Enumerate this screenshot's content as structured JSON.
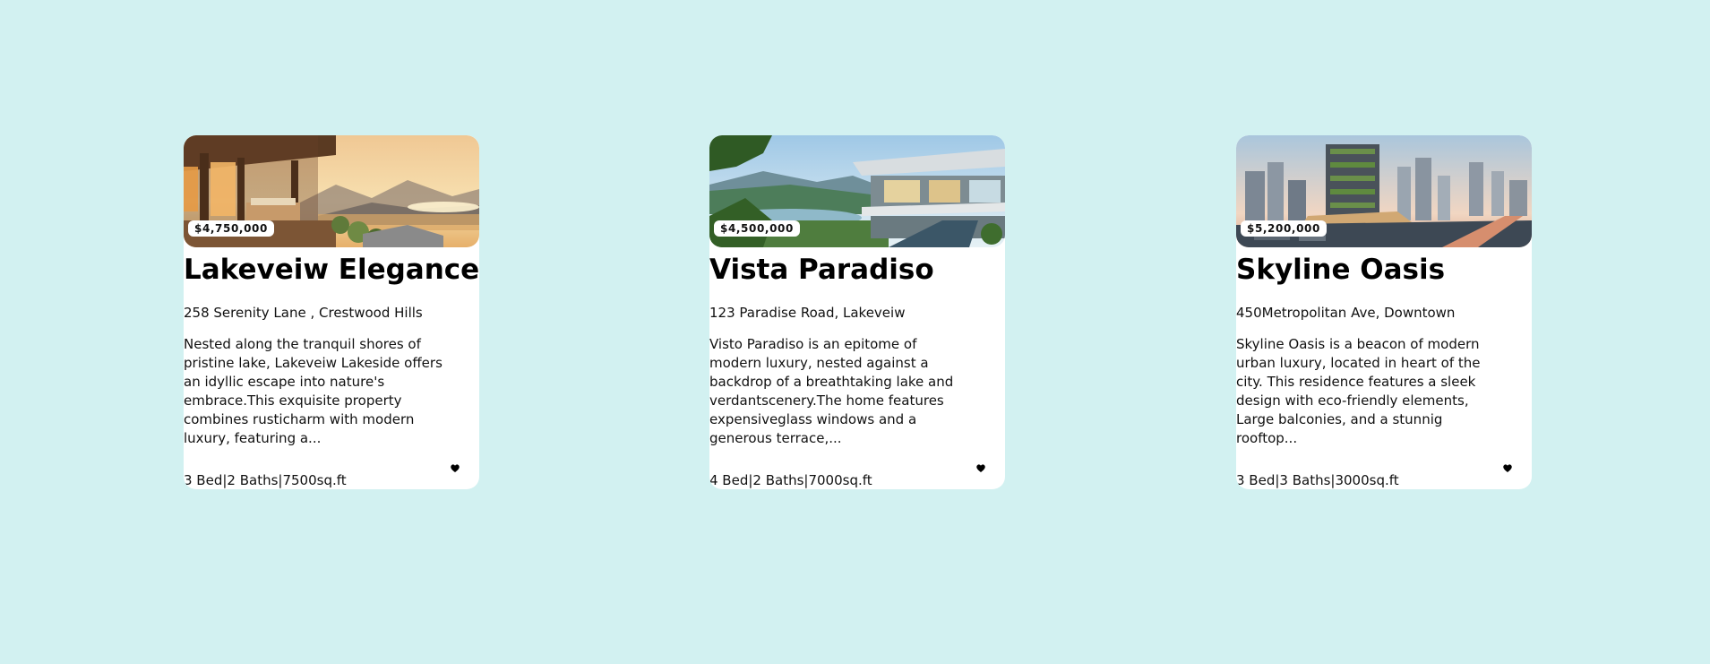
{
  "listings": [
    {
      "price": "$4,750,000",
      "title": "Lakeveiw Elegance",
      "address": "258 Serenity Lane , Crestwood Hills",
      "description": "Nested along the tranquil shores of pristine lake, Lakeveiw Lakeside offers an idyllic escape into nature's embrace.This exquisite property combines rusticharm with modern luxury, featuring a...",
      "specs": "3 Bed|2 Baths|7500sq.ft",
      "favorite_icon": "heart-icon"
    },
    {
      "price": "$4,500,000",
      "title": "Vista Paradiso",
      "address": "123 Paradise Road, Lakeveiw",
      "description": "Visto Paradiso is an epitome of modern luxury, nested against a backdrop of a breathtaking lake and verdantscenery.The home features expensiveglass windows and a generous terrace,...",
      "specs": "4 Bed|2 Baths|7000sq.ft",
      "favorite_icon": "heart-icon"
    },
    {
      "price": "$5,200,000",
      "title": "Skyline Oasis",
      "address": "450Metropolitan Ave, Downtown",
      "description": "Skyline Oasis is a beacon of modern urban luxury, located in heart of the city. This residence features a sleek design with eco-friendly elements, Large balconies, and a stunnig rooftop...",
      "specs": "3 Bed|3 Baths|3000sq.ft",
      "favorite_icon": "heart-icon"
    }
  ],
  "colors": {
    "page_background": "#d2f1f1",
    "card_background": "#ffffff",
    "text": "#111111"
  }
}
